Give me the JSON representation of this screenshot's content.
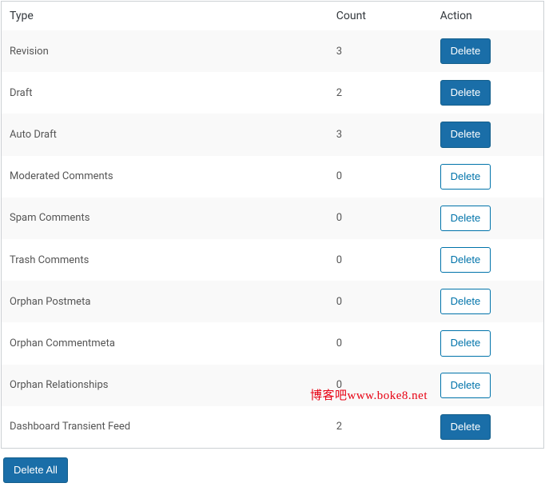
{
  "headers": {
    "type": "Type",
    "count": "Count",
    "action": "Action"
  },
  "rows": [
    {
      "type": "Revision",
      "count": "3",
      "primary": true
    },
    {
      "type": "Draft",
      "count": "2",
      "primary": true
    },
    {
      "type": "Auto Draft",
      "count": "3",
      "primary": true
    },
    {
      "type": "Moderated Comments",
      "count": "0",
      "primary": false
    },
    {
      "type": "Spam Comments",
      "count": "0",
      "primary": false
    },
    {
      "type": "Trash Comments",
      "count": "0",
      "primary": false
    },
    {
      "type": "Orphan Postmeta",
      "count": "0",
      "primary": false
    },
    {
      "type": "Orphan Commentmeta",
      "count": "0",
      "primary": false
    },
    {
      "type": "Orphan Relationships",
      "count": "0",
      "primary": false
    },
    {
      "type": "Dashboard Transient Feed",
      "count": "2",
      "primary": true
    }
  ],
  "action_label": "Delete",
  "delete_all_label": "Delete All",
  "watermark": "博客吧www.boke8.net"
}
